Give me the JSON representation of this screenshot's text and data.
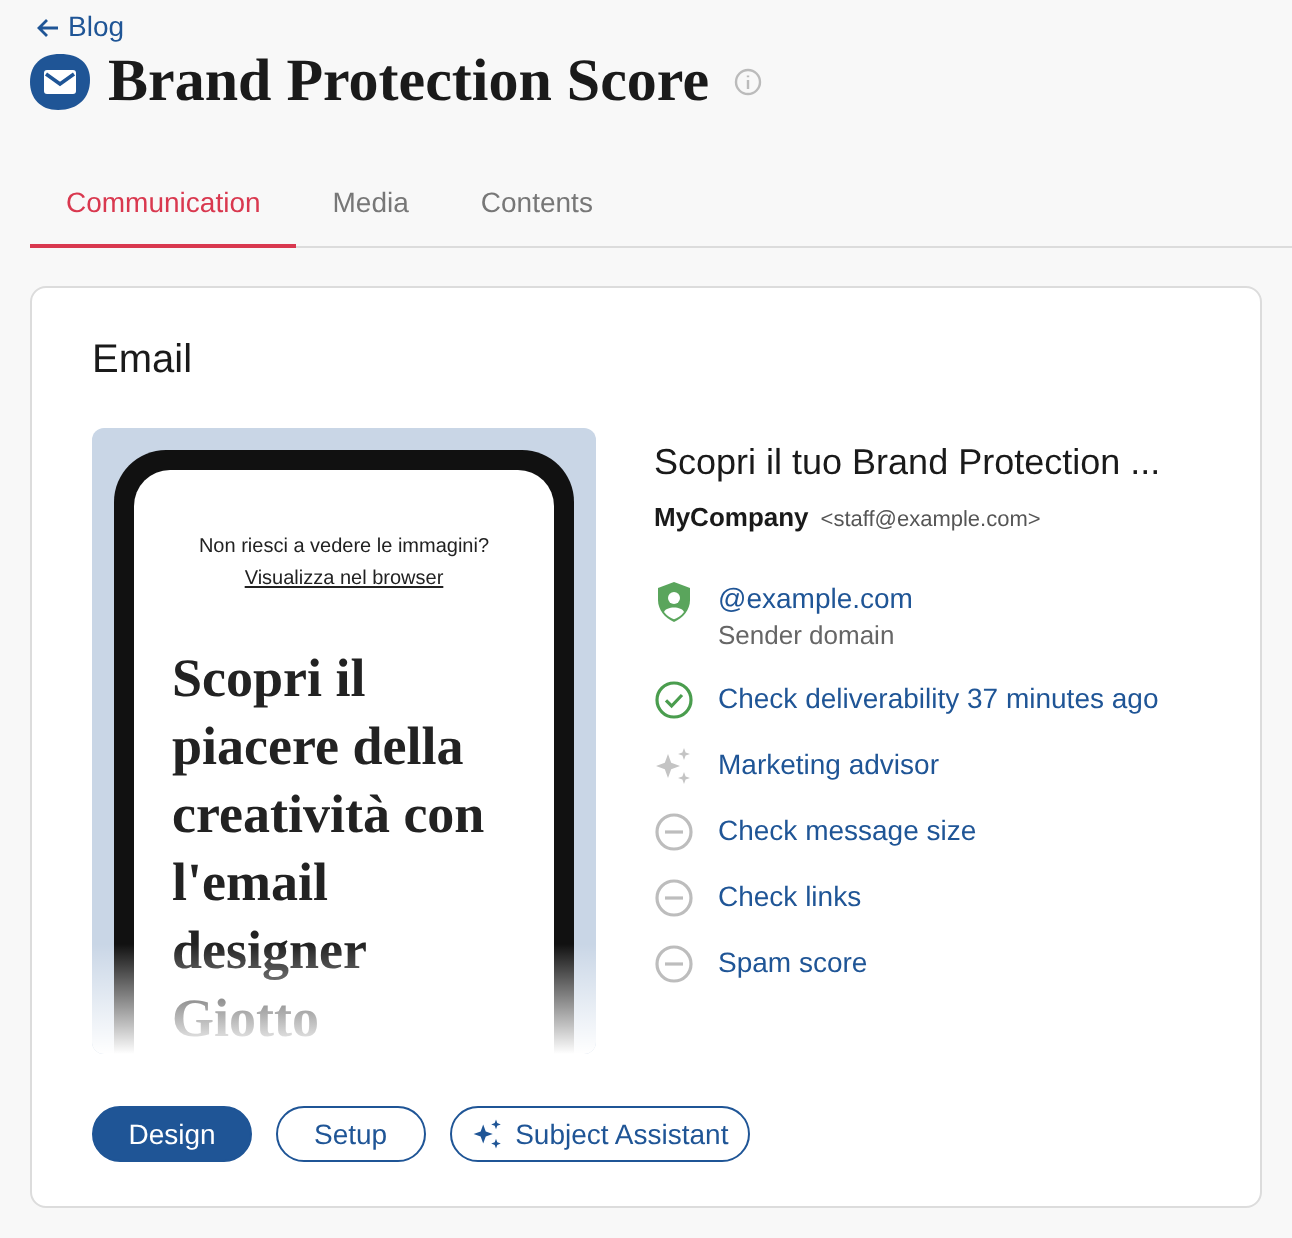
{
  "back_link": {
    "label": "Blog"
  },
  "title": "Brand Protection Score",
  "tabs": [
    {
      "label": "Communication",
      "selected": true
    },
    {
      "label": "Media",
      "selected": false
    },
    {
      "label": "Contents",
      "selected": false
    }
  ],
  "card": {
    "heading": "Email",
    "preview": {
      "notice": "Non riesci a vedere le immagini?",
      "browser_link": "Visualizza nel browser",
      "headline": "Scopri il piacere della creatività con l'email designer Giotto"
    },
    "subject": "Scopri il tuo Brand Protection ...",
    "sender_name": "MyCompany",
    "sender_email": "<staff@example.com>",
    "checks": [
      {
        "kind": "domain",
        "label": "@example.com",
        "sublabel": "Sender domain"
      },
      {
        "kind": "done",
        "label": "Check deliverability 37 minutes ago"
      },
      {
        "kind": "advisor",
        "label": "Marketing advisor"
      },
      {
        "kind": "pending",
        "label": "Check message size"
      },
      {
        "kind": "pending",
        "label": "Check links"
      },
      {
        "kind": "pending",
        "label": "Spam score"
      }
    ],
    "buttons": [
      {
        "kind": "primary",
        "label": "Design"
      },
      {
        "kind": "outline",
        "label": "Setup"
      },
      {
        "kind": "sparkle",
        "label": "Subject Assistant"
      }
    ]
  }
}
